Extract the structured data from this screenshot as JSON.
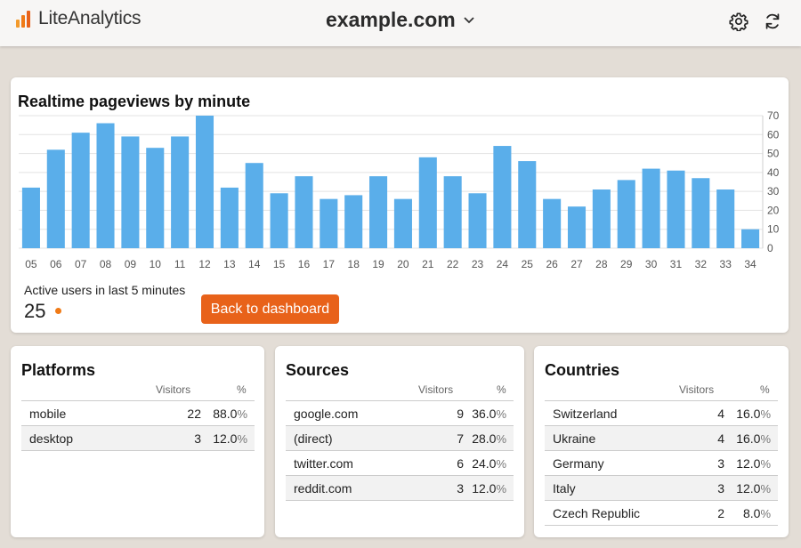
{
  "header": {
    "logo_text": "LiteAnalytics",
    "site_name": "example.com",
    "icons": [
      "logo-bars-icon",
      "chevron-down-icon",
      "gear-icon",
      "refresh-icon"
    ]
  },
  "realtime": {
    "title": "Realtime pageviews by minute",
    "active_label": "Active users in last 5 minutes",
    "active_count": "25",
    "back_button": "Back to dashboard"
  },
  "chart_data": {
    "type": "bar",
    "categories": [
      "05",
      "06",
      "07",
      "08",
      "09",
      "10",
      "11",
      "12",
      "13",
      "14",
      "15",
      "16",
      "17",
      "18",
      "19",
      "20",
      "21",
      "22",
      "23",
      "24",
      "25",
      "26",
      "27",
      "28",
      "29",
      "30",
      "31",
      "32",
      "33",
      "34"
    ],
    "values": [
      32,
      52,
      61,
      66,
      59,
      53,
      59,
      70,
      32,
      45,
      29,
      38,
      26,
      28,
      38,
      26,
      48,
      38,
      29,
      54,
      46,
      26,
      22,
      31,
      36,
      42,
      41,
      37,
      31,
      10
    ],
    "ylim": [
      0,
      70
    ],
    "yticks": [
      "70",
      "60",
      "50",
      "40",
      "30",
      "20",
      "10",
      "0"
    ],
    "y_axis_side": "right",
    "grid": true,
    "bar_color": "#5aaeea"
  },
  "platforms": {
    "title": "Platforms",
    "col_visitors": "Visitors",
    "col_pct": "%",
    "rows": [
      {
        "name": "mobile",
        "visitors": "22",
        "pct": "88.0"
      },
      {
        "name": "desktop",
        "visitors": "3",
        "pct": "12.0"
      }
    ]
  },
  "sources": {
    "title": "Sources",
    "col_visitors": "Visitors",
    "col_pct": "%",
    "rows": [
      {
        "name": "google.com",
        "visitors": "9",
        "pct": "36.0"
      },
      {
        "name": "(direct)",
        "visitors": "7",
        "pct": "28.0"
      },
      {
        "name": "twitter.com",
        "visitors": "6",
        "pct": "24.0"
      },
      {
        "name": "reddit.com",
        "visitors": "3",
        "pct": "12.0"
      }
    ]
  },
  "countries": {
    "title": "Countries",
    "col_visitors": "Visitors",
    "col_pct": "%",
    "rows": [
      {
        "name": "Switzerland",
        "visitors": "4",
        "pct": "16.0"
      },
      {
        "name": "Ukraine",
        "visitors": "4",
        "pct": "16.0"
      },
      {
        "name": "Germany",
        "visitors": "3",
        "pct": "12.0"
      },
      {
        "name": "Italy",
        "visitors": "3",
        "pct": "12.0"
      },
      {
        "name": "Czech Republic",
        "visitors": "2",
        "pct": "8.0"
      }
    ]
  },
  "pct_sign": "%",
  "colors": {
    "accent": "#e8621a",
    "live_dot": "#f07a16",
    "bar": "#5aaeea"
  }
}
